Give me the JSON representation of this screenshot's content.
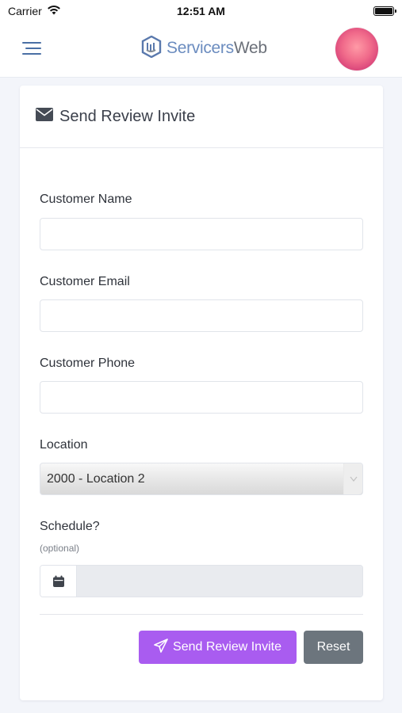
{
  "status_bar": {
    "carrier": "Carrier",
    "time": "12:51 AM"
  },
  "header": {
    "logo_text_a": "Servicers",
    "logo_text_b": "Web"
  },
  "card": {
    "title": "Send Review Invite"
  },
  "form": {
    "customer_name": {
      "label": "Customer Name",
      "value": "",
      "placeholder": ""
    },
    "customer_email": {
      "label": "Customer Email",
      "value": "",
      "placeholder": ""
    },
    "customer_phone": {
      "label": "Customer Phone",
      "value": "",
      "placeholder": ""
    },
    "location": {
      "label": "Location",
      "selected": "2000 - Location 2"
    },
    "schedule": {
      "label": "Schedule?",
      "hint": "(optional)",
      "value": ""
    }
  },
  "actions": {
    "send_label": "Send Review Invite",
    "reset_label": "Reset"
  },
  "colors": {
    "primary": "#a95cf0",
    "secondary": "#6c757d",
    "logo_blue": "#6b8cbf"
  },
  "icons": [
    "wifi-icon",
    "battery-icon",
    "menu-icon",
    "logo-icon",
    "envelope-icon",
    "chevron-down-icon",
    "calendar-icon",
    "paper-plane-icon"
  ]
}
